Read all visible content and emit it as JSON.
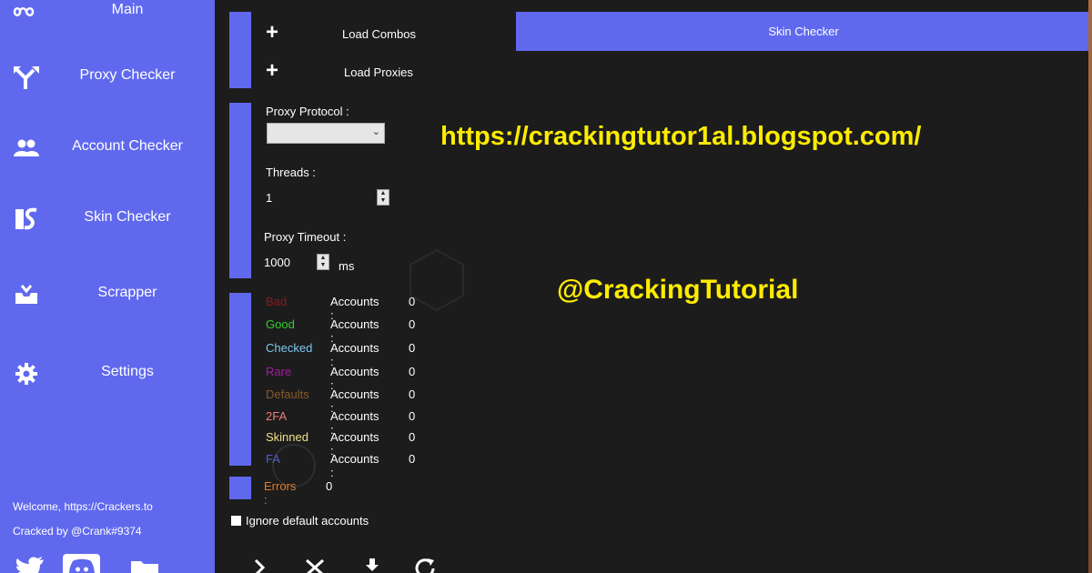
{
  "sidebar": {
    "items": [
      {
        "label": "Main",
        "icon": "infinity-icon"
      },
      {
        "label": "Proxy Checker",
        "icon": "fork-arrow-icon"
      },
      {
        "label": "Account Checker",
        "icon": "users-icon"
      },
      {
        "label": "Skin Checker",
        "icon": "brush-s-icon"
      },
      {
        "label": "Scrapper",
        "icon": "tray-icon"
      },
      {
        "label": "Settings",
        "icon": "gear-icon"
      }
    ],
    "welcome": "Welcome, https://Crackers.to",
    "cracked_by": "Cracked by @Crank#9374",
    "social": [
      "twitter-icon",
      "discord-icon",
      "folder-icon"
    ]
  },
  "toolbar": {
    "load_combos": "Load Combos",
    "load_proxies": "Load Proxies",
    "skin_checker_tab": "Skin Checker"
  },
  "settings": {
    "proxy_protocol_label": "Proxy Protocol :",
    "proxy_protocol_value": "",
    "threads_label": "Threads :",
    "threads_value": "1",
    "proxy_timeout_label": "Proxy Timeout :",
    "proxy_timeout_value": "1000",
    "timeout_unit": "ms"
  },
  "stats": {
    "accounts_label": "Accounts :",
    "rows": [
      {
        "name": "Bad",
        "value": "0",
        "color": "#8b1a1a"
      },
      {
        "name": "Good",
        "value": "0",
        "color": "#2fd12f"
      },
      {
        "name": "Checked",
        "value": "0",
        "color": "#7ec8f0"
      },
      {
        "name": "Rare",
        "value": "0",
        "color": "#a01fa0"
      },
      {
        "name": "Defaults",
        "value": "0",
        "color": "#8a5a2b"
      },
      {
        "name": "2FA",
        "value": "0",
        "color": "#f07a7a"
      },
      {
        "name": "Skinned",
        "value": "0",
        "color": "#f0e08a"
      },
      {
        "name": "FA",
        "value": "0",
        "color": "#5060c8"
      }
    ],
    "errors_label": "Errors :",
    "errors_value": "0",
    "errors_color": "#e07a2a"
  },
  "options": {
    "ignore_default_label": "Ignore default accounts"
  },
  "watermarks": {
    "url": "https://crackingtutor1al.blogspot.com/",
    "handle": "@CrackingTutorial"
  },
  "colors": {
    "accent": "#6069ee",
    "background": "#1c1c1c",
    "watermark": "#ffec00"
  }
}
